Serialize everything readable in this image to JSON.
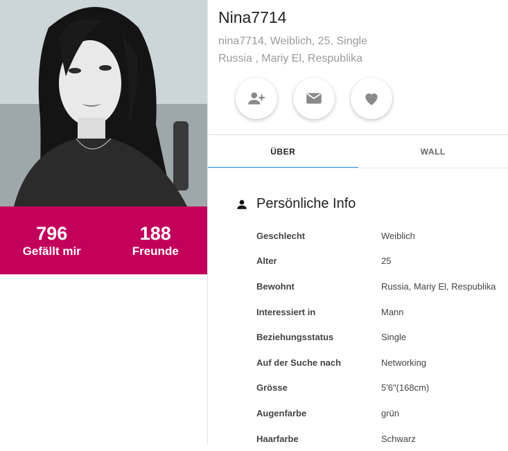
{
  "profile": {
    "username": "Nina7714",
    "subtitle_line1": "nina7714, Weiblich, 25, Single",
    "subtitle_line2": "Russia , Mariy El, Respublika"
  },
  "stats": [
    {
      "value": "796",
      "label": "Gefällt mir"
    },
    {
      "value": "188",
      "label": "Freunde"
    }
  ],
  "actions": [
    {
      "icon": "add-friend-icon"
    },
    {
      "icon": "mail-icon"
    },
    {
      "icon": "heart-icon"
    }
  ],
  "tabs": [
    {
      "label": "ÜBER",
      "active": true
    },
    {
      "label": "WALL",
      "active": false
    }
  ],
  "section": {
    "icon": "person-icon",
    "title": "Persönliche Info"
  },
  "info_rows": [
    {
      "key": "Geschlecht",
      "value": "Weiblich"
    },
    {
      "key": "Alter",
      "value": "25"
    },
    {
      "key": "Bewohnt",
      "value": "Russia, Mariy El, Respublika"
    },
    {
      "key": "Interessiert in",
      "value": "Mann"
    },
    {
      "key": "Beziehungsstatus",
      "value": "Single"
    },
    {
      "key": "Auf der Suche nach",
      "value": "Networking"
    },
    {
      "key": "Grösse",
      "value": "5'6\"(168cm)"
    },
    {
      "key": "Augenfarbe",
      "value": "grün"
    },
    {
      "key": "Haarfarbe",
      "value": "Schwarz"
    }
  ],
  "colors": {
    "accent": "#c2005b",
    "tab_indicator": "#2196f3",
    "icon_gray": "#8a8a8a"
  }
}
